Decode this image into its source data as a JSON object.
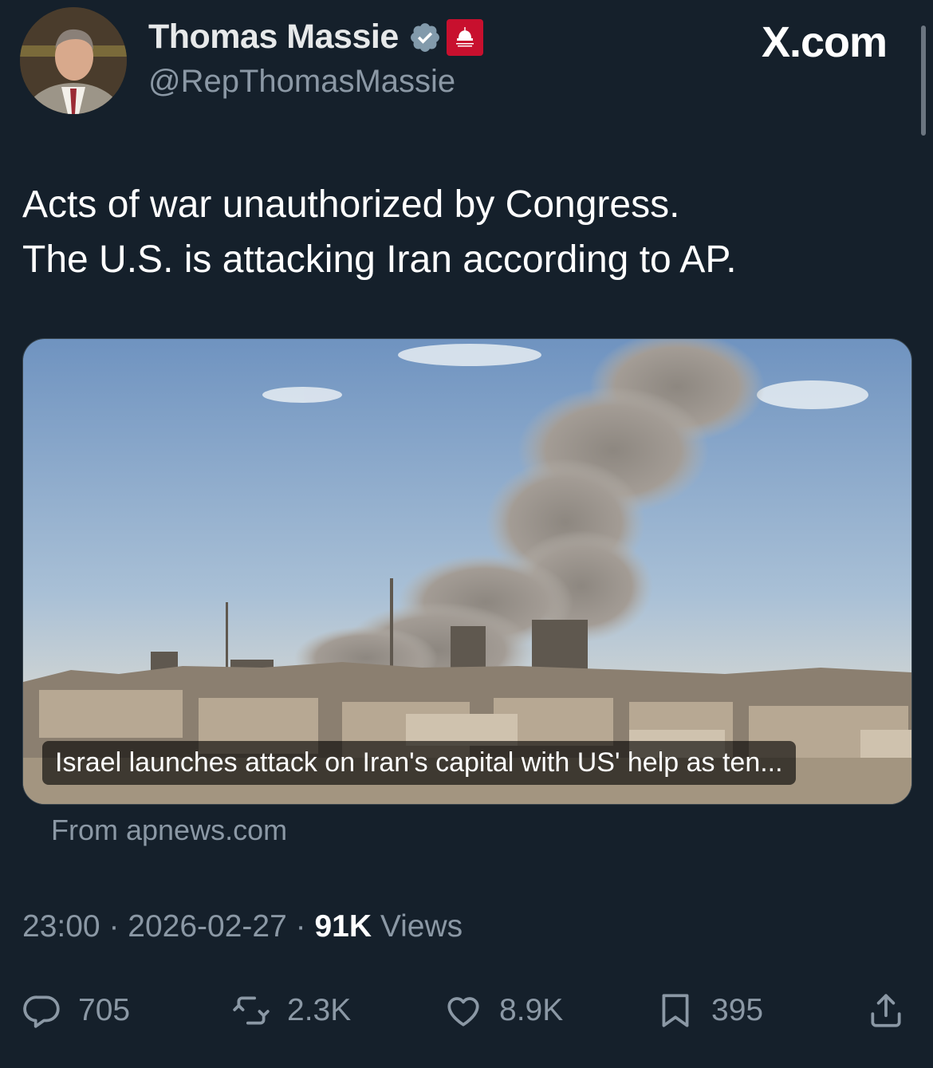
{
  "author": {
    "name": "Thomas Massie",
    "handle": "@RepThomasMassie",
    "verified_color": "#829aab",
    "affiliation_badge_color": "#c8102e"
  },
  "header": {
    "brand": "X.com"
  },
  "tweet": {
    "lines": [
      "Acts of war unauthorized by Congress.",
      "The U.S. is attacking Iran according to AP."
    ]
  },
  "card": {
    "caption": "Israel launches attack on Iran's capital with US' help as ten...",
    "source": "From apnews.com"
  },
  "meta": {
    "time": "23:00",
    "sep1": " · ",
    "date": "2026-02-27",
    "sep2": " · ",
    "views_count": "91K",
    "views_label": " Views"
  },
  "actions": {
    "replies": "705",
    "reposts": "2.3K",
    "likes": "8.9K",
    "bookmarks": "395"
  },
  "colors": {
    "background": "#15202b",
    "secondary_text": "#8b98a5",
    "primary_text": "#e7e9ea"
  }
}
